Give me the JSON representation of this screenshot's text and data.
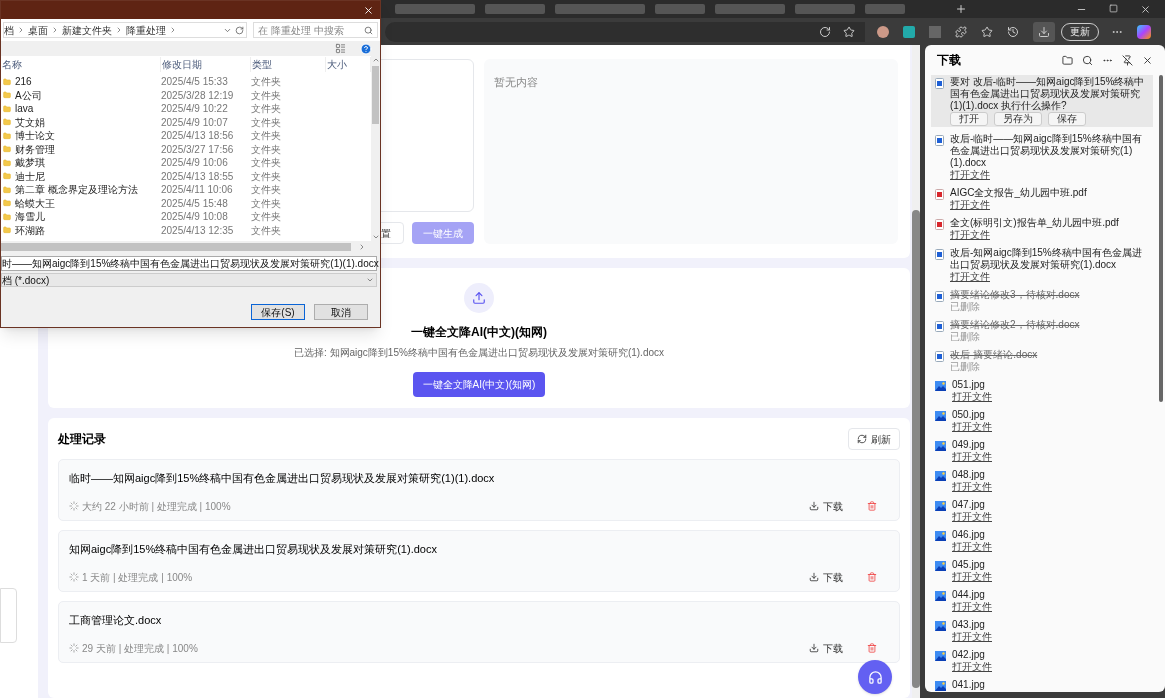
{
  "browser": {
    "update_button": "更新"
  },
  "file_dialog": {
    "breadcrumb": [
      "档",
      "桌面",
      "新建文件夹",
      "降重处理"
    ],
    "search_placeholder": "在 降重处理 中搜索",
    "columns": [
      "名称",
      "修改日期",
      "类型",
      "大小"
    ],
    "rows": [
      {
        "name": "216",
        "modified": "2025/4/5 15:33",
        "type": "文件夹"
      },
      {
        "name": "A公司",
        "modified": "2025/3/28 12:19",
        "type": "文件夹"
      },
      {
        "name": "lava",
        "modified": "2025/4/9 10:22",
        "type": "文件夹"
      },
      {
        "name": "艾文娟",
        "modified": "2025/4/9 10:07",
        "type": "文件夹"
      },
      {
        "name": "博士论文",
        "modified": "2025/4/13 18:56",
        "type": "文件夹"
      },
      {
        "name": "财务管理",
        "modified": "2025/3/27 17:56",
        "type": "文件夹"
      },
      {
        "name": "戴梦琪",
        "modified": "2025/4/9 10:06",
        "type": "文件夹"
      },
      {
        "name": "迪士尼",
        "modified": "2025/4/13 18:55",
        "type": "文件夹"
      },
      {
        "name": "第二章 概念界定及理论方法",
        "modified": "2025/4/11 10:06",
        "type": "文件夹"
      },
      {
        "name": "蛤蟆大王",
        "modified": "2025/4/5 15:48",
        "type": "文件夹"
      },
      {
        "name": "海雪儿",
        "modified": "2025/4/9 10:08",
        "type": "文件夹"
      },
      {
        "name": "环湖路",
        "modified": "2025/4/13 12:35",
        "type": "文件夹"
      }
    ],
    "file_name": "时——知网aigc降到15%终稿中国有色金属进出口贸易现状及发展对策研究(1)(1).docx",
    "file_type": "档 (*.docx)",
    "buttons": [
      {
        "label": "保存(S)",
        "default": true
      },
      {
        "label": "取消",
        "default": false
      }
    ]
  },
  "editor": {
    "reset_button": "置",
    "generate_button": {
      "label": "一键生成",
      "disabled": true
    },
    "output_placeholder": "暂无内容"
  },
  "upload": {
    "title": "一键全文降AI(中文)(知网)",
    "selected_file": "已选择: 知网aigc降到15%终稿中国有色金属进出口贸易现状及发展对策研究(1).docx",
    "button": "一键全文降AI(中文)(知网)"
  },
  "records": {
    "title": "处理记录",
    "refresh": "刷新",
    "items": [
      {
        "name": "临时——知网aigc降到15%终稿中国有色金属进出口贸易现状及发展对策研究(1)(1).docx",
        "meta": "大约 22 小时前 | 处理完成 | 100%",
        "download": "下载"
      },
      {
        "name": "知网aigc降到15%终稿中国有色金属进出口贸易现状及发展对策研究(1).docx",
        "meta": "1 天前 | 处理完成 | 100%",
        "download": "下载"
      },
      {
        "name": "工商管理论文.docx",
        "meta": "29 天前 | 处理完成 | 100%",
        "download": "下载"
      }
    ]
  },
  "downloads": {
    "title": "下载",
    "items": [
      {
        "kind": "doc",
        "name": "要对 改后-临时——知网aigc降到15%终稿中国有色金属进出口贸易现状及发展对策研究(1)(1).docx 执行什么操作?",
        "selected": true,
        "buttons": [
          "打开",
          "另存为",
          "保存"
        ]
      },
      {
        "kind": "doc",
        "name": "改后-临时——知网aigc降到15%终稿中国有色金属进出口贸易现状及发展对策研究(1)(1).docx",
        "selected": false,
        "deleted": false,
        "note": "打开文件"
      },
      {
        "kind": "pdf",
        "name": "AIGC全文报告_幼儿园中班.pdf",
        "selected": false,
        "deleted": false,
        "note": "打开文件"
      },
      {
        "kind": "pdf",
        "name": "全文(标明引文)报告单_幼儿园中班.pdf",
        "selected": false,
        "deleted": false,
        "note": "打开文件"
      },
      {
        "kind": "doc",
        "name": "改后-知网aigc降到15%终稿中国有色金属进出口贸易现状及发展对策研究(1).docx",
        "selected": false,
        "deleted": false,
        "note": "打开文件"
      },
      {
        "kind": "doc",
        "name": "摘要绪论修改3，待核对.docx",
        "selected": false,
        "deleted": true,
        "note": "已删除"
      },
      {
        "kind": "doc",
        "name": "摘要绪论修改2，待核对.docx",
        "selected": false,
        "deleted": true,
        "note": "已删除"
      },
      {
        "kind": "doc",
        "name": "改后-摘要绪论.docx",
        "selected": false,
        "deleted": true,
        "note": "已删除"
      },
      {
        "kind": "image",
        "name": "051.jpg",
        "selected": false,
        "deleted": false,
        "note": "打开文件"
      },
      {
        "kind": "image",
        "name": "050.jpg",
        "selected": false,
        "deleted": false,
        "note": "打开文件"
      },
      {
        "kind": "image",
        "name": "049.jpg",
        "selected": false,
        "deleted": false,
        "note": "打开文件"
      },
      {
        "kind": "image",
        "name": "048.jpg",
        "selected": false,
        "deleted": false,
        "note": "打开文件"
      },
      {
        "kind": "image",
        "name": "047.jpg",
        "selected": false,
        "deleted": false,
        "note": "打开文件"
      },
      {
        "kind": "image",
        "name": "046.jpg",
        "selected": false,
        "deleted": false,
        "note": "打开文件"
      },
      {
        "kind": "image",
        "name": "045.jpg",
        "selected": false,
        "deleted": false,
        "note": "打开文件"
      },
      {
        "kind": "image",
        "name": "044.jpg",
        "selected": false,
        "deleted": false,
        "note": "打开文件"
      },
      {
        "kind": "image",
        "name": "043.jpg",
        "selected": false,
        "deleted": false,
        "note": "打开文件"
      },
      {
        "kind": "image",
        "name": "042.jpg",
        "selected": false,
        "deleted": false,
        "note": "打开文件"
      },
      {
        "kind": "image",
        "name": "041.jpg",
        "selected": false,
        "deleted": false
      }
    ]
  }
}
